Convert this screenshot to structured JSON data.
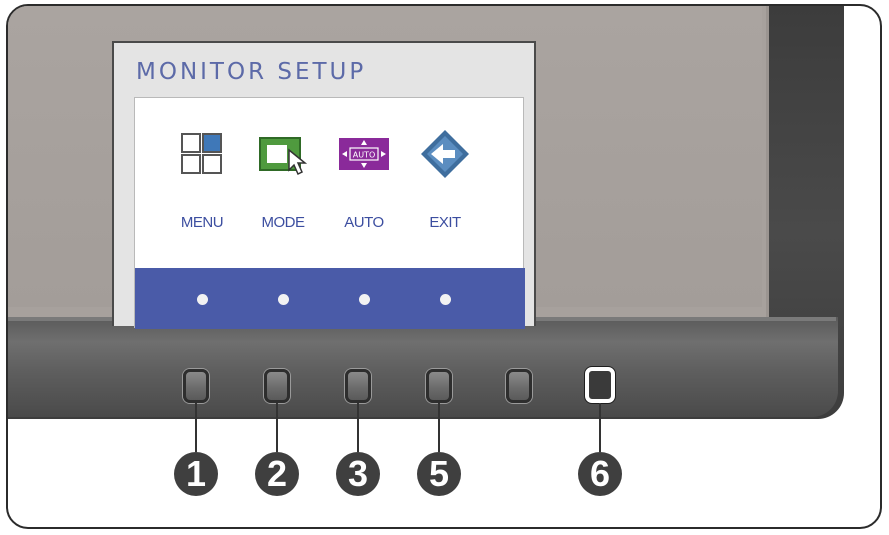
{
  "osd": {
    "title": "MONITOR SETUP",
    "items": [
      {
        "label": "MENU",
        "icon": "menu-grid-icon"
      },
      {
        "label": "MODE",
        "icon": "mode-window-icon"
      },
      {
        "label": "AUTO",
        "icon": "auto-adjust-icon"
      },
      {
        "label": "EXIT",
        "icon": "exit-arrow-icon"
      }
    ],
    "colors": {
      "title": "#5c6aa8",
      "label": "#3c4ea0",
      "bar": "#4a5ba8"
    }
  },
  "callouts": [
    "1",
    "2",
    "3",
    "5",
    "6"
  ]
}
